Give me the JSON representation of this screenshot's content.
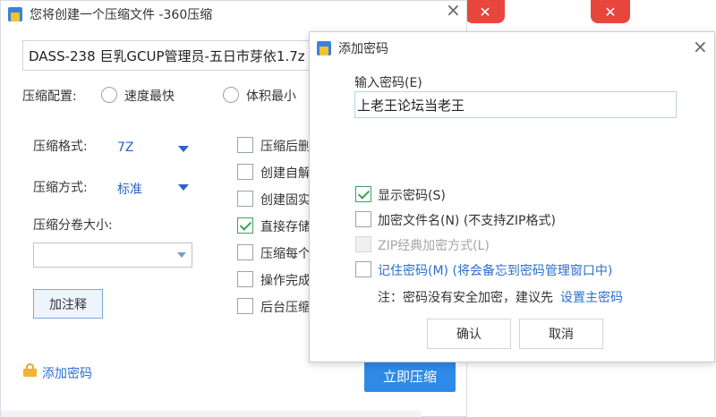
{
  "main_window": {
    "title": "您将创建一个压缩文件 -360压缩",
    "filename": "DASS-238 巨乳GCUP管理员-五日市芽依1.7z",
    "config": {
      "label": "压缩配置:",
      "options": [
        "速度最快",
        "体积最小"
      ]
    },
    "format": {
      "label": "压缩格式:",
      "value": "7Z"
    },
    "method": {
      "label": "压缩方式:",
      "value": "标准"
    },
    "volume": {
      "label": "压缩分卷大小:",
      "value": ""
    },
    "comment_button": "加注释",
    "options": [
      {
        "label": "压缩后删",
        "checked": false
      },
      {
        "label": "创建自解",
        "checked": false
      },
      {
        "label": "创建固实",
        "checked": false
      },
      {
        "label": "直接存储",
        "checked": true
      },
      {
        "label": "压缩每个",
        "checked": false
      },
      {
        "label": "操作完成",
        "checked": false
      },
      {
        "label": "后台压缩",
        "checked": false
      }
    ],
    "add_password_link": "添加密码",
    "compress_button": "立即压缩"
  },
  "dialog": {
    "title": "添加密码",
    "password_label": "输入密码(E)",
    "password_value": "上老王论坛当老王",
    "show_password": "显示密码(S)",
    "encrypt_filename": "加密文件名(N) (不支持ZIP格式)",
    "zip_classic": "ZIP经典加密方式(L)",
    "remember_password": "记住密码(M) (将会备忘到密码管理窗口中)",
    "note_prefix": "注：密码没有安全加密，建议先",
    "note_link": "设置主密码",
    "ok_button": "确认",
    "cancel_button": "取消"
  },
  "colors": {
    "accent": "#2e8ae6",
    "link": "#2b6fd1",
    "check_green": "#3aa25a",
    "pdf_red": "#e8453c"
  }
}
